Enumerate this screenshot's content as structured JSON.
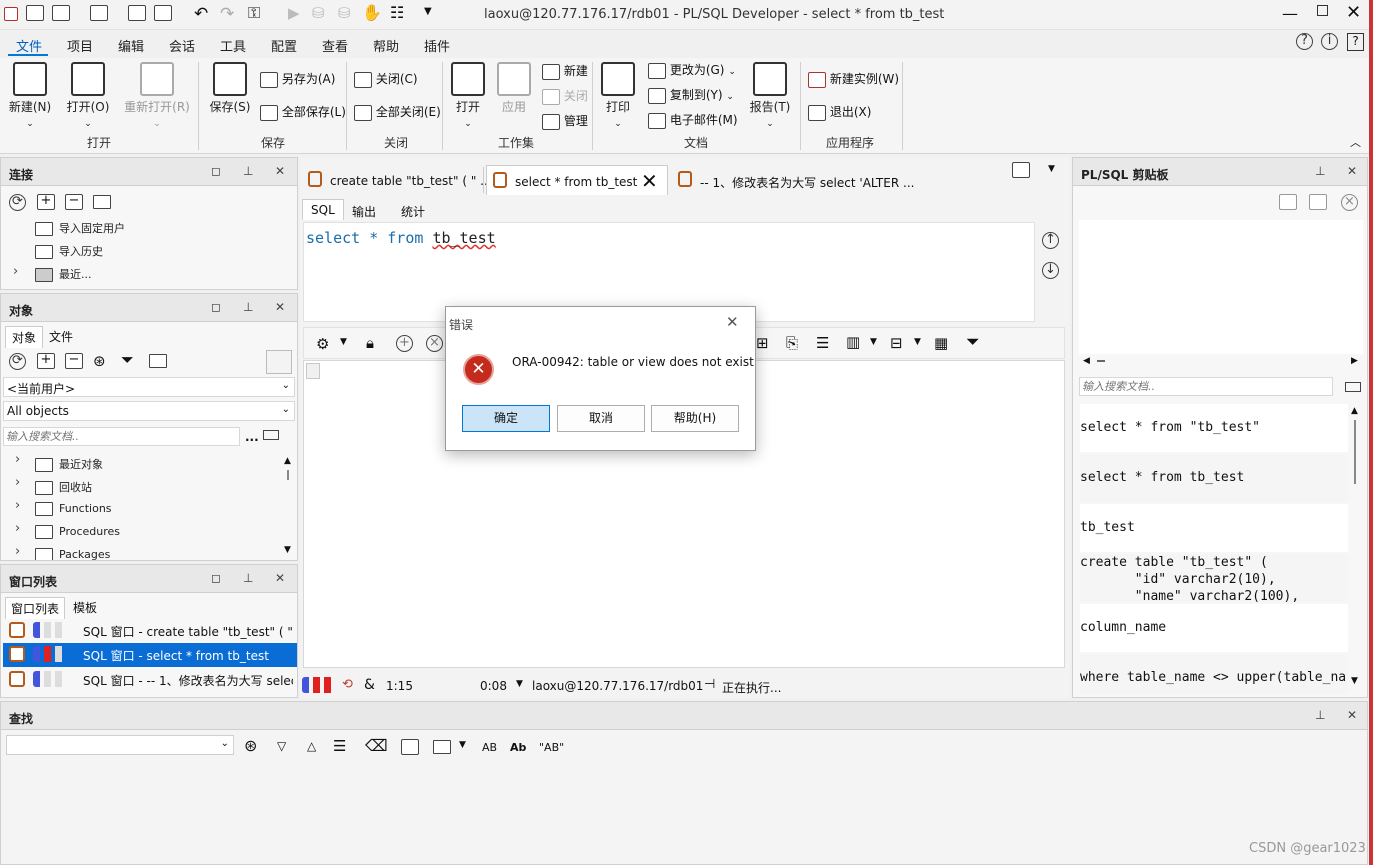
{
  "window": {
    "title": "laoxu@120.77.176.17/rdb01 - PL/SQL Developer - select * from tb_test"
  },
  "menu": [
    "文件",
    "项目",
    "编辑",
    "会话",
    "工具",
    "配置",
    "查看",
    "帮助",
    "插件"
  ],
  "ribbon": {
    "new": "新建(N)",
    "open": "打开(O)",
    "reopen": "重新打开(R)",
    "group_open": "打开",
    "save": "保存(S)",
    "save_as": "另存为(A)",
    "save_all": "全部保存(L)",
    "group_save": "保存",
    "close": "关闭(C)",
    "close_all": "全部关闭(E)",
    "group_close": "关闭",
    "ws_open": "打开",
    "ws_apply": "应用",
    "ws_new": "新建",
    "ws_close": "关闭",
    "ws_manage": "管理",
    "group_workspace": "工作集",
    "print": "打印",
    "change_to": "更改为(G)",
    "copy_to": "复制到(Y)",
    "email": "电子邮件(M)",
    "report": "报告(T)",
    "group_doc": "文档",
    "new_instance": "新建实例(W)",
    "exit": "退出(X)",
    "group_app": "应用程序"
  },
  "connection_panel": {
    "title": "连接",
    "items": [
      "导入固定用户",
      "导入历史",
      "最近..."
    ]
  },
  "object_panel": {
    "title": "对象",
    "tabs": [
      "对象",
      "文件"
    ],
    "user_select": "<当前用户>",
    "filter_select": "All objects",
    "search_placeholder": "输入搜索文档..",
    "more": "...",
    "items": [
      "最近对象",
      "回收站",
      "Functions",
      "Procedures",
      "Packages"
    ]
  },
  "window_list": {
    "title": "窗口列表",
    "tabs": [
      "窗口列表",
      "模板"
    ],
    "items": [
      "SQL 窗口 - create table \"tb_test\" ( \"..",
      "SQL 窗口 - select * from tb_test",
      "SQL 窗口 - -- 1、修改表名为大写 selec"
    ]
  },
  "editor": {
    "doc_tabs": [
      "create table \"tb_test\" ( \" ...",
      "select * from tb_test",
      "-- 1、修改表名为大写 select 'ALTER ..."
    ],
    "sub_tabs": [
      "SQL",
      "输出",
      "统计"
    ],
    "code_kw1": "select",
    "code_star": "*",
    "code_kw2": "from",
    "code_ident": "tb_test"
  },
  "status_bar": {
    "time1": "1:15",
    "time2": "0:08",
    "conn": "laoxu@120.77.176.17/rdb01",
    "state": "正在执行...",
    "amp": "&"
  },
  "dialog": {
    "title": "错误",
    "message": "ORA-00942: table or view does not exist",
    "ok": "确定",
    "cancel": "取消",
    "help": "帮助(H)"
  },
  "clipboard": {
    "title": "PL/SQL 剪贴板",
    "search_placeholder": "输入搜索文档..",
    "items": [
      "select * from \"tb_test\"",
      "select * from tb_test",
      "tb_test",
      "create table \"tb_test\" (\n       \"id\" varchar2(10),\n       \"name\" varchar2(100),",
      "column_name",
      "where table_name <> upper(table_na"
    ]
  },
  "find_panel": {
    "title": "查找",
    "opt_ab": "AB",
    "opt_ab2": "Ab",
    "opt_quoted": "\"AB\""
  },
  "watermark": "CSDN @gear1023",
  "colors": {
    "accent": "#0078d7",
    "selection": "#0a6dd6",
    "error": "#c42b1c",
    "keyword": "#1a6fa8"
  }
}
